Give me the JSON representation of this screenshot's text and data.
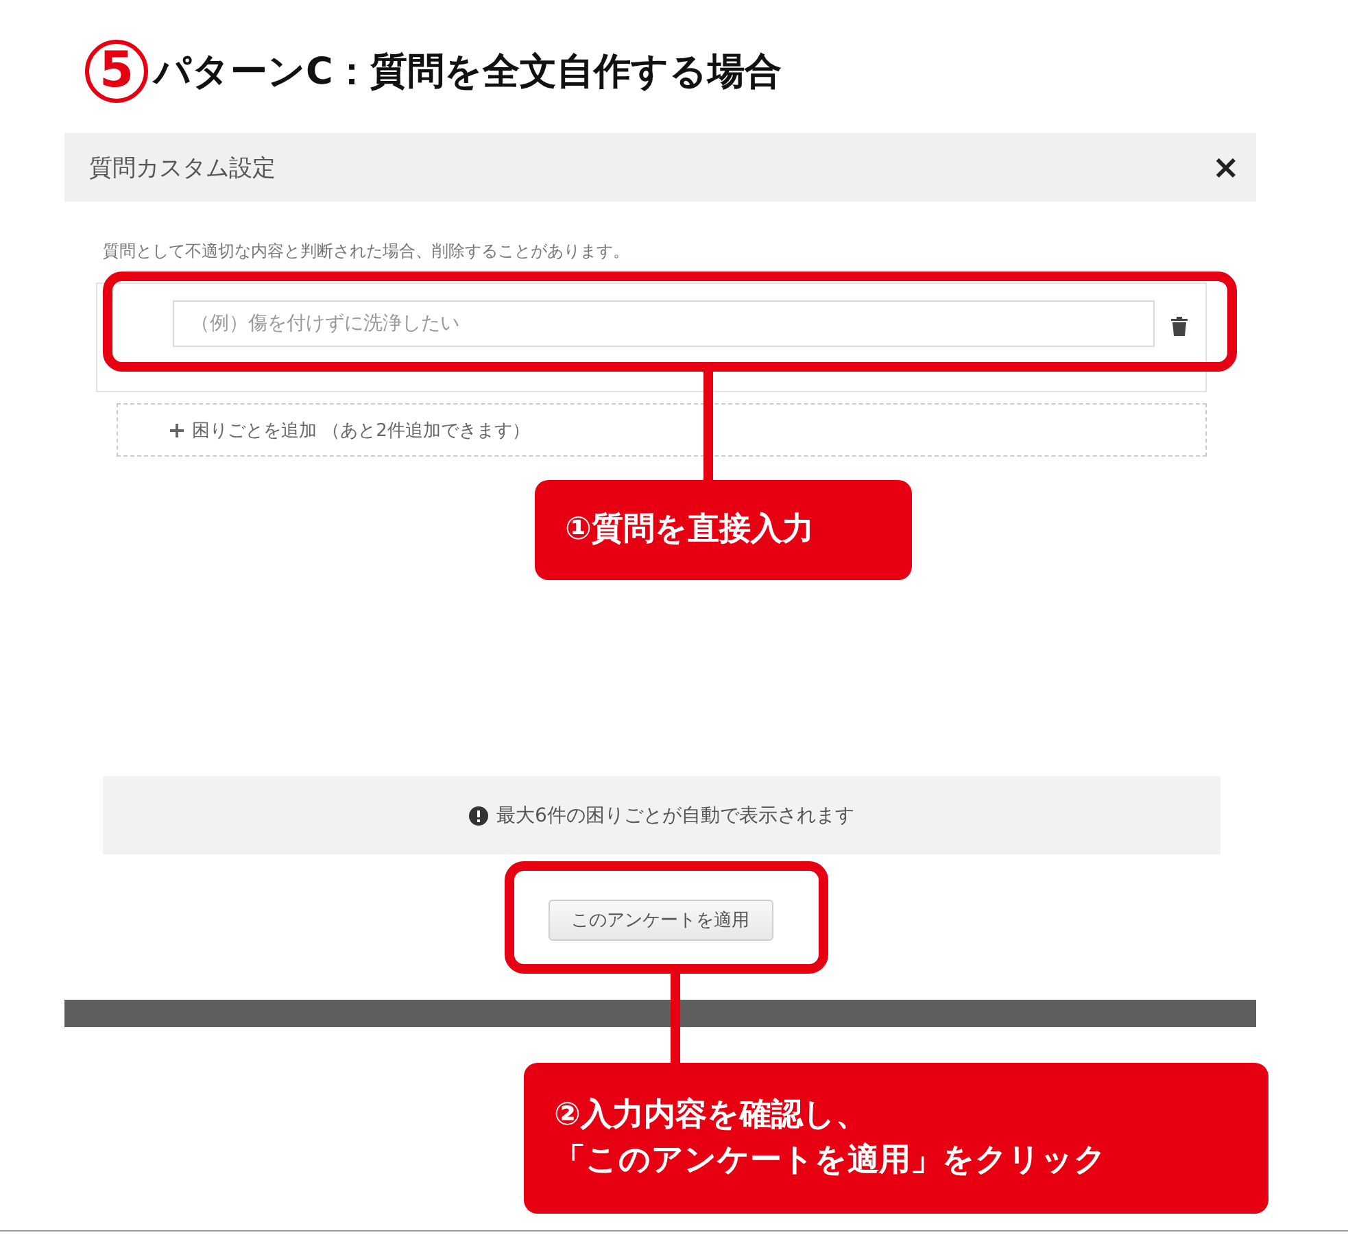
{
  "heading": {
    "number": "5",
    "text": "パターンC：質問を全文自作する場合"
  },
  "dialog": {
    "title": "質問カスタム設定",
    "close": "×",
    "notice": "質問として不適切な内容と判断された場合、削除することがあります。",
    "questions": [
      {
        "placeholder": "（例）傷を付けずに洗浄したい"
      }
    ],
    "add_button": "困りごとを追加 （あと2件追加できます）",
    "info": "最大6件の困りごとが自動で表示されます",
    "apply_button": "このアンケートを適用"
  },
  "callouts": [
    {
      "text": "①質問を直接入力"
    },
    {
      "lines": [
        "②入力内容を確認し、",
        "「このアンケートを適用」をクリック"
      ]
    }
  ]
}
